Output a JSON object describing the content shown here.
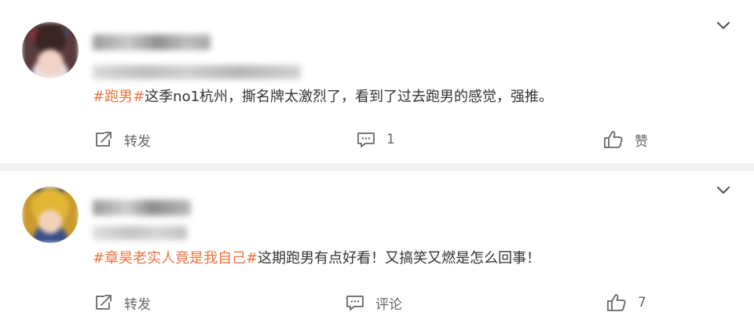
{
  "posts": [
    {
      "hashtag": "#跑男#",
      "text": "这季no1杭州，撕名牌太激烈了，看到了过去跑男的感觉，强推。",
      "forward_label": "转发",
      "comment_value": "1",
      "like_value": "赞"
    },
    {
      "hashtag": "#章昊老实人竟是我自己#",
      "text": "这期跑男有点好看！又搞笑又燃是怎么回事！",
      "forward_label": "转发",
      "comment_value": "评论",
      "like_value": "7"
    }
  ],
  "icons": {
    "expand": "chevron-down-icon",
    "forward": "share-icon",
    "comment": "comment-icon",
    "like": "thumbs-up-icon"
  },
  "colors": {
    "hashtag": "#eb7340",
    "text": "#333333",
    "action": "#666666",
    "divider": "#f2f2f2"
  }
}
